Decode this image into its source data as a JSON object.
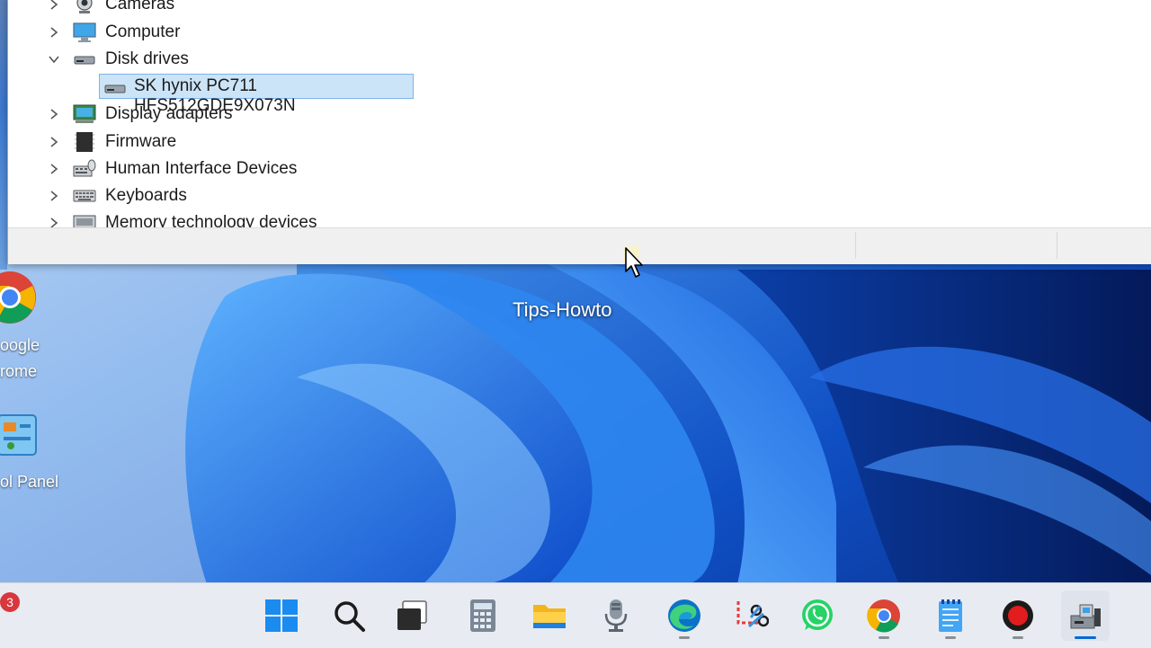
{
  "device_manager": {
    "tree": [
      {
        "label": "Cameras",
        "state": "collapsed",
        "icon": "camera-icon"
      },
      {
        "label": "Computer",
        "state": "collapsed",
        "icon": "monitor-icon"
      },
      {
        "label": "Disk drives",
        "state": "expanded",
        "icon": "disk-drive-icon",
        "children": [
          {
            "label": "SK hynix PC711 HFS512GDE9X073N",
            "icon": "disk-drive-icon",
            "selected": true
          }
        ]
      },
      {
        "label": "Display adapters",
        "state": "collapsed",
        "icon": "display-adapter-icon"
      },
      {
        "label": "Firmware",
        "state": "collapsed",
        "icon": "firmware-chip-icon"
      },
      {
        "label": "Human Interface Devices",
        "state": "collapsed",
        "icon": "hid-icon"
      },
      {
        "label": "Keyboards",
        "state": "collapsed",
        "icon": "keyboard-icon"
      },
      {
        "label": "Memory technology devices",
        "state": "collapsed",
        "icon": "memory-device-icon"
      }
    ]
  },
  "desktop": {
    "icons": [
      {
        "label_line1": "oogle",
        "label_line2": "rome",
        "icon": "chrome-icon"
      },
      {
        "label_line1": "ol Panel",
        "icon": "control-panel-icon"
      }
    ],
    "watermark": "Tips-Howto"
  },
  "taskbar": {
    "notification_count": "3",
    "items": [
      {
        "icon": "windows-start-icon",
        "running": false
      },
      {
        "icon": "search-icon",
        "running": false
      },
      {
        "icon": "task-view-icon",
        "running": false
      },
      {
        "icon": "calculator-icon",
        "running": false
      },
      {
        "icon": "file-explorer-icon",
        "running": false
      },
      {
        "icon": "microphone-icon",
        "running": false
      },
      {
        "icon": "edge-icon",
        "running": true
      },
      {
        "icon": "snipping-tool-icon",
        "running": false
      },
      {
        "icon": "whatsapp-icon",
        "running": false
      },
      {
        "icon": "chrome-icon",
        "running": true
      },
      {
        "icon": "notepad-icon",
        "running": true
      },
      {
        "icon": "screen-recorder-icon",
        "running": true
      },
      {
        "icon": "device-manager-icon",
        "running": true,
        "active": true
      }
    ]
  },
  "colors": {
    "selection_bg": "#cce4f7",
    "selection_border": "#7eb4ea",
    "taskbar_accent": "#0a67d6"
  }
}
